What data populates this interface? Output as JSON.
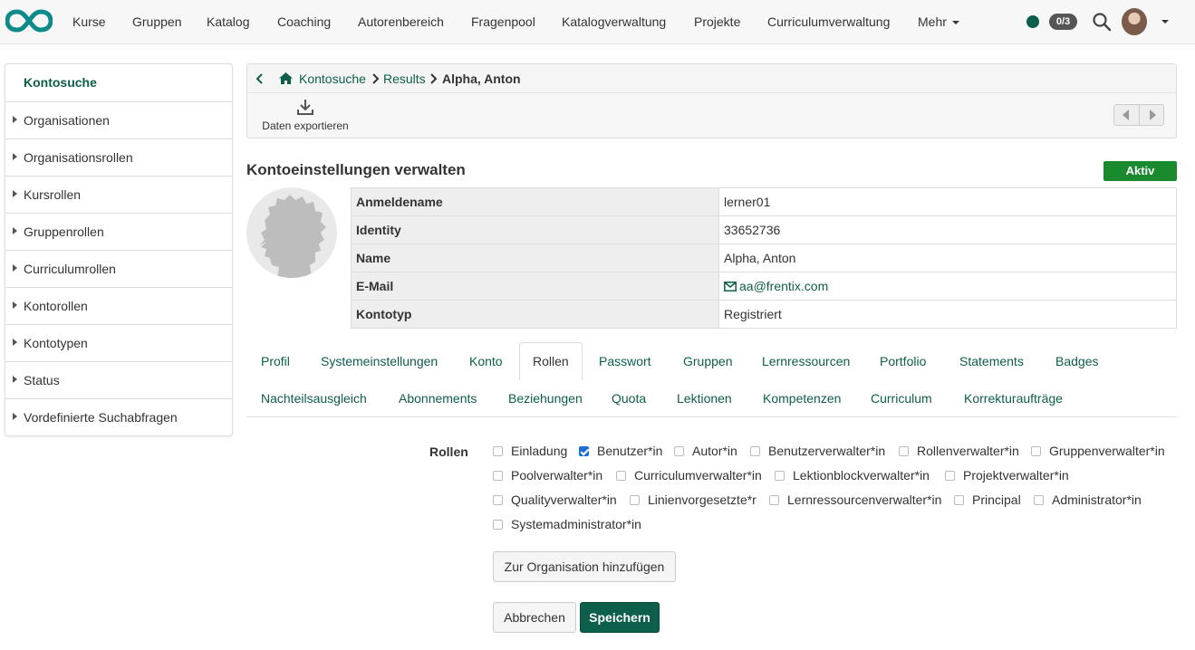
{
  "nav": {
    "items": [
      "Kurse",
      "Gruppen",
      "Katalog",
      "Coaching",
      "Autorenbereich",
      "Fragenpool",
      "Katalogverwaltung",
      "Projekte",
      "Curriculumverwaltung",
      "Mehr"
    ],
    "counter": "0/3",
    "status_color": "#0d5e4a"
  },
  "sidebar": {
    "items": [
      {
        "label": "Kontosuche"
      },
      {
        "label": "Organisationen"
      },
      {
        "label": "Organisationsrollen"
      },
      {
        "label": "Kursrollen"
      },
      {
        "label": "Gruppenrollen"
      },
      {
        "label": "Curriculumrollen"
      },
      {
        "label": "Kontorollen"
      },
      {
        "label": "Kontotypen"
      },
      {
        "label": "Status"
      },
      {
        "label": "Vordefinierte Suchabfragen"
      }
    ]
  },
  "breadcrumb": {
    "items": [
      "Kontosuche",
      "Results",
      "Alpha, Anton"
    ]
  },
  "toolbar": {
    "export_label": "Daten exportieren"
  },
  "page": {
    "title": "Kontoeinstellungen verwalten",
    "status_badge": "Aktiv"
  },
  "account": {
    "rows": [
      {
        "key": "Anmeldename",
        "value": "lerner01"
      },
      {
        "key": "Identity",
        "value": "33652736"
      },
      {
        "key": "Name",
        "value": "Alpha, Anton"
      },
      {
        "key": "E-Mail",
        "value": "aa@frentix.com"
      },
      {
        "key": "Kontotyp",
        "value": "Registriert"
      }
    ]
  },
  "tabs": {
    "row1": [
      "Profil",
      "Systemeinstellungen",
      "Konto",
      "Rollen",
      "Passwort",
      "Gruppen",
      "Lernressourcen",
      "Portfolio",
      "Statements",
      "Badges"
    ],
    "row2": [
      "Nachteilsausgleich",
      "Abonnements",
      "Beziehungen",
      "Quota",
      "Lektionen",
      "Kompetenzen",
      "Curriculum",
      "Korrekturaufträge"
    ],
    "active": "Rollen"
  },
  "roles": {
    "label": "Rollen",
    "options": [
      {
        "label": "Einladung",
        "checked": false
      },
      {
        "label": "Benutzer*in",
        "checked": true
      },
      {
        "label": "Autor*in",
        "checked": false
      },
      {
        "label": "Benutzerverwalter*in",
        "checked": false
      },
      {
        "label": "Rollenverwalter*in",
        "checked": false
      },
      {
        "label": "Gruppenverwalter*in",
        "checked": false
      },
      {
        "label": "Poolverwalter*in",
        "checked": false
      },
      {
        "label": "Curriculumverwalter*in",
        "checked": false
      },
      {
        "label": "Lektionblockverwalter*in",
        "checked": false
      },
      {
        "label": "Projektverwalter*in",
        "checked": false
      },
      {
        "label": "Qualityverwalter*in",
        "checked": false
      },
      {
        "label": "Linienvorgesetzte*r",
        "checked": false
      },
      {
        "label": "Lernressourcenverwalter*in",
        "checked": false
      },
      {
        "label": "Principal",
        "checked": false
      },
      {
        "label": "Administrator*in",
        "checked": false
      },
      {
        "label": "Systemadministrator*in",
        "checked": false
      }
    ]
  },
  "buttons": {
    "add_org": "Zur Organisation hinzufügen",
    "cancel": "Abbrechen",
    "save": "Speichern"
  }
}
